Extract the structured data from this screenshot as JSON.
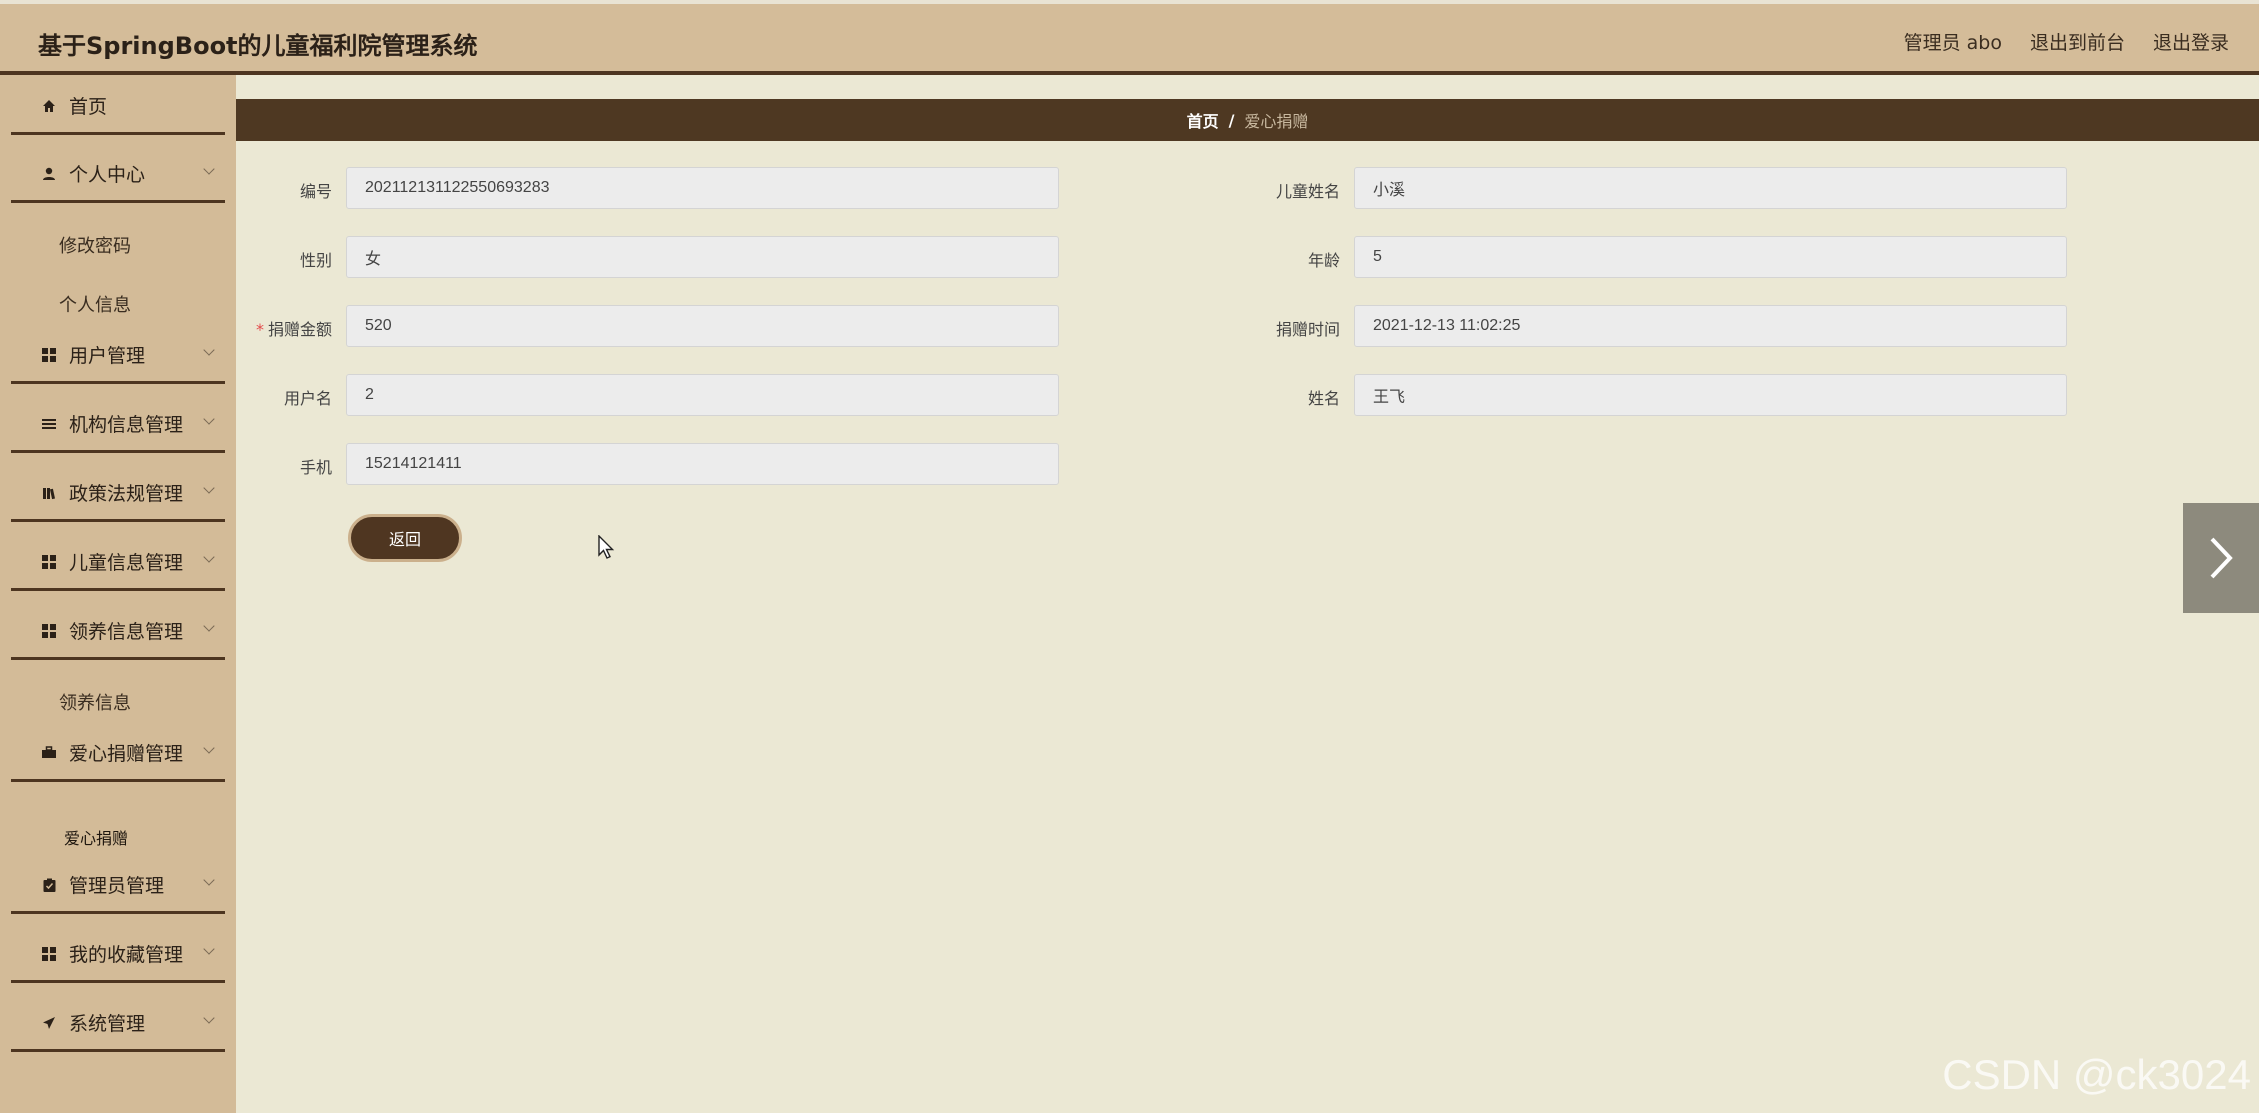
{
  "header": {
    "title": "基于SpringBoot的儿童福利院管理系统",
    "links": [
      "管理员 abo",
      "退出到前台",
      "退出登录"
    ]
  },
  "sidebar": {
    "items": [
      {
        "label": "首页",
        "icon": "home-icon"
      },
      {
        "label": "个人中心",
        "icon": "user-icon"
      },
      {
        "label": "用户管理",
        "icon": "grid-icon"
      },
      {
        "label": "机构信息管理",
        "icon": "list-icon"
      },
      {
        "label": "政策法规管理",
        "icon": "book-icon"
      },
      {
        "label": "儿童信息管理",
        "icon": "grid-icon"
      },
      {
        "label": "领养信息管理",
        "icon": "grid-icon"
      },
      {
        "label": "爱心捐赠管理",
        "icon": "briefcase-icon"
      },
      {
        "label": "管理员管理",
        "icon": "clipboard-icon"
      },
      {
        "label": "我的收藏管理",
        "icon": "grid-icon"
      },
      {
        "label": "系统管理",
        "icon": "paper-plane-icon"
      }
    ],
    "subitems": {
      "personal": [
        "修改密码",
        "个人信息"
      ],
      "adoption": [
        "领养信息"
      ],
      "donation": [
        "爱心捐赠"
      ]
    }
  },
  "breadcrumb": {
    "home": "首页",
    "separator": "/",
    "current": "爱心捐赠"
  },
  "form": {
    "id_label": "编号",
    "id_value": "20211213112255069 3283",
    "child_name_label": "儿童姓名",
    "child_name_value": "小溪",
    "gender_label": "性别",
    "gender_value": "女",
    "age_label": "年龄",
    "age_value": "5",
    "amount_label": "捐赠金额",
    "amount_value": "520",
    "time_label": "捐赠时间",
    "time_value": "2021-12-13 11:02:25",
    "username_label": "用户名",
    "username_value": "2",
    "name_label": "姓名",
    "name_value": "王飞",
    "phone_label": "手机",
    "phone_value": "15214121411",
    "required_mark": "*",
    "back_label": "返回"
  },
  "watermark": "CSDN @ck3024"
}
